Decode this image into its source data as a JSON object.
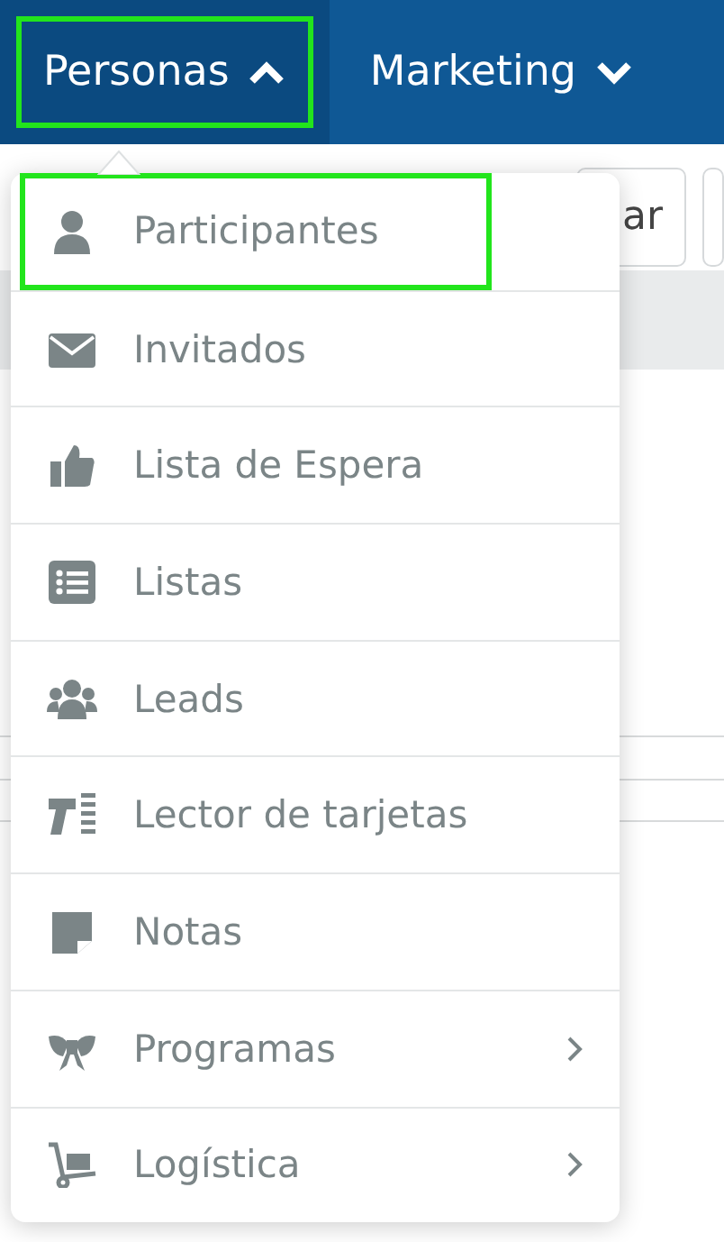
{
  "nav": {
    "items": [
      {
        "label": "Personas",
        "expanded": true,
        "selected": true,
        "highlighted": true
      },
      {
        "label": "Marketing",
        "expanded": false,
        "selected": false,
        "highlighted": false
      }
    ]
  },
  "background": {
    "button_text": "ar"
  },
  "menu": {
    "items": [
      {
        "label": "Participantes",
        "submenu": false,
        "highlighted": true
      },
      {
        "label": "Invitados",
        "submenu": false,
        "highlighted": false
      },
      {
        "label": "Lista de Espera",
        "submenu": false,
        "highlighted": false
      },
      {
        "label": "Listas",
        "submenu": false,
        "highlighted": false
      },
      {
        "label": "Leads",
        "submenu": false,
        "highlighted": false
      },
      {
        "label": "Lector de tarjetas",
        "submenu": false,
        "highlighted": false
      },
      {
        "label": "Notas",
        "submenu": false,
        "highlighted": false
      },
      {
        "label": "Programas",
        "submenu": true,
        "highlighted": false
      },
      {
        "label": "Logística",
        "submenu": true,
        "highlighted": false
      }
    ]
  }
}
